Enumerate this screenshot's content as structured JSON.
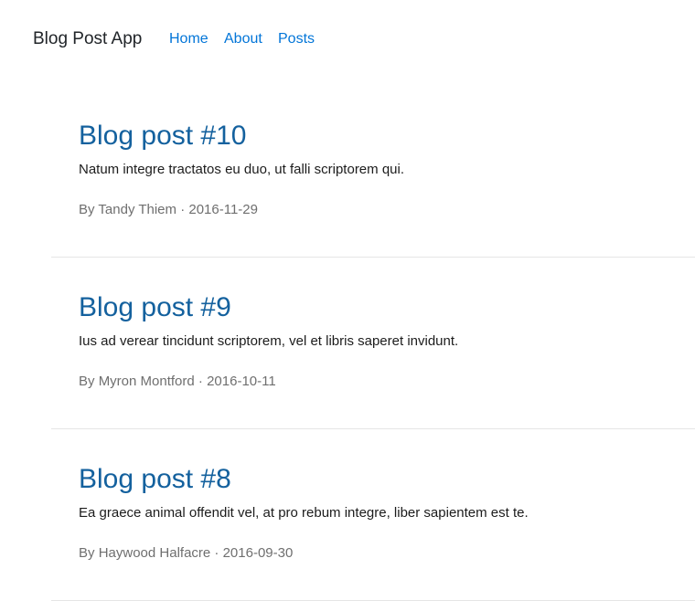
{
  "app": {
    "brand": "Blog Post App"
  },
  "nav": {
    "items": [
      {
        "label": "Home"
      },
      {
        "label": "About"
      },
      {
        "label": "Posts"
      }
    ]
  },
  "posts": [
    {
      "title": "Blog post #10",
      "excerpt": "Natum integre tractatos eu duo, ut falli scriptorem qui.",
      "author_prefix": "By",
      "author": "Tandy Thiem",
      "separator": "·",
      "date": "2016-11-29"
    },
    {
      "title": "Blog post #9",
      "excerpt": "Ius ad verear tincidunt scriptorem, vel et libris saperet invidunt.",
      "author_prefix": "By",
      "author": "Myron Montford",
      "separator": "·",
      "date": "2016-10-11"
    },
    {
      "title": "Blog post #8",
      "excerpt": "Ea graece animal offendit vel, at pro rebum integre, liber sapientem est te.",
      "author_prefix": "By",
      "author": "Haywood Halfacre",
      "separator": "·",
      "date": "2016-09-30"
    }
  ]
}
